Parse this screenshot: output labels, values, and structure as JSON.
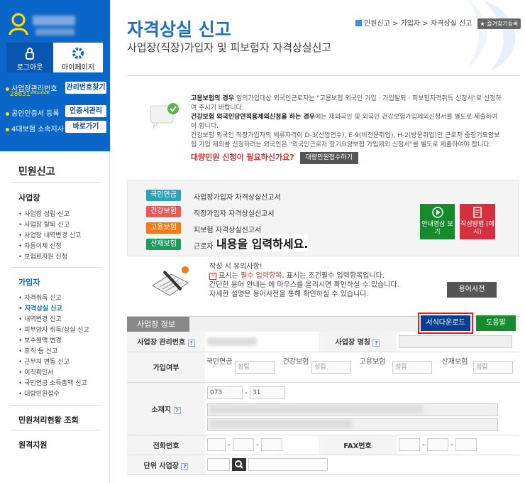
{
  "sidebar": {
    "logout_label": "로그아웃",
    "mypage_label": "마이페이지",
    "biz_no_label": "사업장관리번호",
    "biz_no_value": "28631******",
    "biz_no_btn": "관리번호찾기",
    "cert_label": "공인인증서 등록",
    "cert_btn": "인증서관리",
    "office_label": "4대보험 소속지사",
    "office_btn": "바로가기",
    "menu_title": "민원신고",
    "sec1": "사업장",
    "sec1_items": [
      "사업장 성립 신고",
      "사업장 탈퇴 신고",
      "사업장 내역변경 신고",
      "자동이체 신청",
      "보험료지원 신청"
    ],
    "sec2": "가입자",
    "sec2_items": [
      "자격취득 신고",
      "자격상실 신고",
      "내역변경 신고",
      "피부양자 취득/상실 신고",
      "보수월액 변경",
      "휴직 등 신고",
      "근무처 변동 신고",
      "이직확인서",
      "국민연금 소득총액 신고",
      "대량민원접수"
    ],
    "sec3": "민원처리현황 조회",
    "sec4": "원격지원"
  },
  "page": {
    "title": "자격상실 신고",
    "subtitle": "사업장(직장)가입자 및 피보험자 자격상실신고",
    "crumbs": [
      "민원신고",
      ">",
      "가입자",
      ">",
      "자격상실 신고"
    ],
    "fav_label": "즐겨찾기등록"
  },
  "notice": {
    "l1b": "고용보험의 경우",
    "l1": " 임의가입대상 외국인근로자는 \"고용보험 외국인 가입 · 가입탈퇴 · 피보험자격취득 신청서\"로 신청하여 주시기 바랍니다.",
    "l2b": "건강보험 외국인당연적용제외신청을 하는 경우",
    "l2": "에는 재외국인 및 외국인 건강보험가입제외신청서를 별도로 제출하여야 합니다.",
    "l3": "건강보험 외국인 직장가입자의 체류자격이 D-3(산업연수), E-9(비전문취업), H-2(방문취업)인 근로자 중장기요양보험 가입 제외를 신청하려는 외국인은 \"외국인근로자 장기요양보험 가입제외 신청서\"를 별도로 제출하여야 합니다.",
    "red": "대량민원 신청이 필요하신가요?",
    "btn": "대량민원접수하기"
  },
  "forms": {
    "tags": [
      {
        "label": "국민연금",
        "color": "#2aa3b5",
        "name": "사업장가입자 자격상실신고서"
      },
      {
        "label": "건강보험",
        "color": "#e85a5a",
        "name": "직장가입자 자격상실신고서"
      },
      {
        "label": "고용보험",
        "color": "#ee7a1a",
        "name": "피보험 자격상실신고서"
      },
      {
        "label": "산재보험",
        "color": "#1e9a5a",
        "name": "근로자"
      }
    ],
    "overlay": "내용을 입력하세요.",
    "video_btn": "안내영상 보기",
    "method_btn": "작성방법 (예시)"
  },
  "tips": {
    "title": "작성 시 유의사항!",
    "l1a": " 표시는 ",
    "l1red": "필수 입력항목",
    "l1b": ",  표시는 조건필수 입력항목입니다.",
    "l2": "간단한 용어 안내는  에 마우스를 올리시면 확인하실 수 있습니다.",
    "l3": "자세한 설명은 용어사전을 통해 확인하실 수 있습니다.",
    "dict_btn": "용어사전"
  },
  "bizinfo": {
    "section": "사업장 정보",
    "download_btn": "서식다운로드",
    "help_btn": "도움말",
    "biz_no_label": "사업장 관리번호",
    "biz_name_label": "사업장 명칭",
    "join_label": "가입여부",
    "np": "국민연금",
    "hi": "건강보험",
    "ei": "고용보험",
    "ia": "산재보험",
    "status": "성립",
    "addr_label": "소재지",
    "zip1": "073",
    "zip2": "31",
    "dash": "-",
    "phone_label": "전화번호",
    "fax_label": "FAX번호",
    "unit_label": "단위 사업장"
  }
}
